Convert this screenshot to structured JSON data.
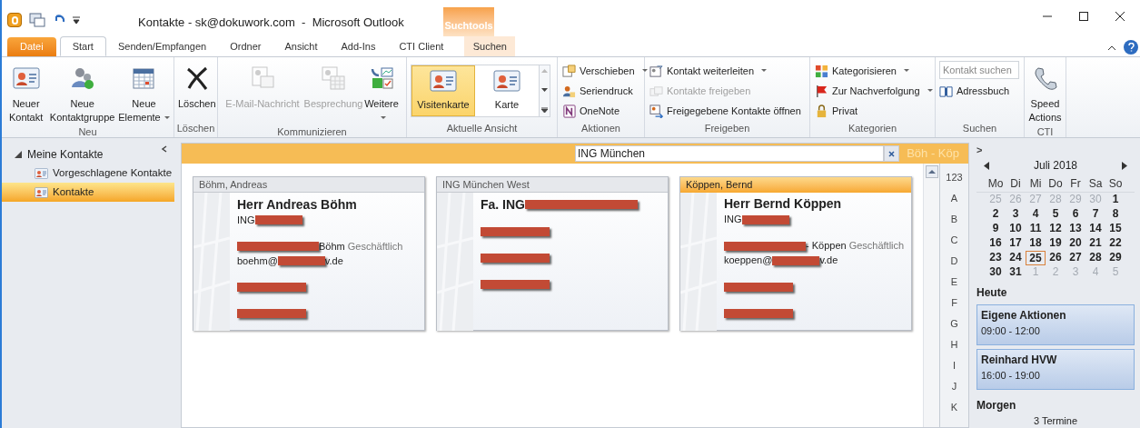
{
  "window": {
    "title": "Kontakte - sk@dokuwork.com  -  Microsoft Outlook",
    "contextual_header": "Suchtools"
  },
  "tabs": [
    {
      "label": "Datei",
      "kind": "file",
      "selected": false
    },
    {
      "label": "Start",
      "kind": "tab",
      "selected": true
    },
    {
      "label": "Senden/Empfangen",
      "kind": "tab",
      "selected": false
    },
    {
      "label": "Ordner",
      "kind": "tab",
      "selected": false
    },
    {
      "label": "Ansicht",
      "kind": "tab",
      "selected": false
    },
    {
      "label": "Add-Ins",
      "kind": "tab",
      "selected": false
    },
    {
      "label": "CTI Client",
      "kind": "tab",
      "selected": false
    },
    {
      "label": "Suchen",
      "kind": "contextual",
      "selected": false
    }
  ],
  "ribbon": {
    "groups": [
      {
        "label": "Neu",
        "items": [
          {
            "label": "Neuer Kontakt",
            "dropdown": false,
            "disabled": false
          },
          {
            "label": "Neue Kontaktgruppe",
            "dropdown": false,
            "disabled": false
          },
          {
            "label": "Neue Elemente",
            "dropdown": true,
            "disabled": false
          }
        ]
      },
      {
        "label": "Löschen",
        "items": [
          {
            "label": "Löschen",
            "dropdown": false,
            "disabled": false
          }
        ]
      },
      {
        "label": "Kommunizieren",
        "items": [
          {
            "label": "E-Mail-Nachricht",
            "dropdown": false,
            "disabled": true
          },
          {
            "label": "Besprechung",
            "dropdown": false,
            "disabled": true
          },
          {
            "label": "Weitere",
            "dropdown": true,
            "disabled": false
          }
        ]
      },
      {
        "label": "Aktuelle Ansicht",
        "items": [
          {
            "label": "Visitenkarte",
            "selected": true
          },
          {
            "label": "Karte",
            "selected": false
          }
        ]
      },
      {
        "label": "Aktionen",
        "items": [
          {
            "label": "Verschieben",
            "dropdown": true,
            "disabled": false
          },
          {
            "label": "Seriendruck",
            "dropdown": false,
            "disabled": false
          },
          {
            "label": "OneNote",
            "dropdown": false,
            "disabled": false
          }
        ]
      },
      {
        "label": "Freigeben",
        "items": [
          {
            "label": "Kontakt weiterleiten",
            "dropdown": true,
            "disabled": false
          },
          {
            "label": "Kontakte freigeben",
            "dropdown": false,
            "disabled": true
          },
          {
            "label": "Freigegebene Kontakte öffnen",
            "dropdown": false,
            "disabled": false
          }
        ]
      },
      {
        "label": "Kategorien",
        "items": [
          {
            "label": "Kategorisieren",
            "dropdown": true,
            "disabled": false
          },
          {
            "label": "Zur Nachverfolgung",
            "dropdown": true,
            "disabled": false
          },
          {
            "label": "Privat",
            "dropdown": false,
            "disabled": false
          }
        ]
      },
      {
        "label": "Suchen",
        "search": {
          "placeholder": "Kontakt suchen"
        },
        "items": [
          {
            "label": "Adressbuch",
            "dropdown": false,
            "disabled": false
          }
        ]
      },
      {
        "label": "CTI",
        "items": [
          {
            "label": "Speed Actions",
            "dropdown": false,
            "disabled": false
          }
        ]
      }
    ]
  },
  "navigation": {
    "items": [
      {
        "label": "Meine Kontakte",
        "expanded": true,
        "selected": false,
        "children": [
          {
            "label": "Vorgeschlagene Kontakte",
            "selected": false
          },
          {
            "label": "Kontakte",
            "selected": true
          }
        ]
      }
    ]
  },
  "contacts": {
    "search": {
      "value": "ING München"
    },
    "range": "Böh - Köp",
    "cards": [
      {
        "header": "Böhm, Andreas",
        "selected": false,
        "blocks": [
          [
            [
              {
                "kind": "text",
                "text": "Herr Andreas Böhm"
              }
            ],
            [
              {
                "kind": "text",
                "text": "ING "
              },
              {
                "kind": "redaction"
              }
            ]
          ],
          [
            [
              {
                "kind": "redaction"
              },
              {
                "kind": "text",
                "text": " Böhm"
              },
              {
                "kind": "label",
                "text": "Geschäftlich"
              }
            ],
            [
              {
                "kind": "text",
                "text": "boehm@"
              },
              {
                "kind": "redaction"
              },
              {
                "kind": "text",
                "text": "v.de"
              }
            ]
          ],
          [
            [
              {
                "kind": "redaction"
              }
            ]
          ],
          [
            [
              {
                "kind": "redaction"
              }
            ]
          ]
        ]
      },
      {
        "header": "ING München West",
        "selected": false,
        "blocks": [
          [
            [
              {
                "kind": "text",
                "text": "Fa. ING"
              },
              {
                "kind": "redaction"
              }
            ]
          ],
          [
            [
              {
                "kind": "redaction"
              }
            ]
          ],
          [
            [
              {
                "kind": "redaction"
              }
            ]
          ],
          [
            [
              {
                "kind": "redaction"
              }
            ]
          ]
        ]
      },
      {
        "header": "Köppen, Bernd",
        "selected": true,
        "blocks": [
          [
            [
              {
                "kind": "text",
                "text": "Herr Bernd Köppen"
              }
            ],
            [
              {
                "kind": "text",
                "text": "ING "
              },
              {
                "kind": "redaction"
              }
            ]
          ],
          [
            [
              {
                "kind": "redaction"
              },
              {
                "kind": "text",
                "text": " - Köppen"
              },
              {
                "kind": "label",
                "text": "Geschäftlich"
              }
            ],
            [
              {
                "kind": "text",
                "text": "koeppen@"
              },
              {
                "kind": "redaction"
              },
              {
                "kind": "text",
                "text": "v.de"
              }
            ]
          ],
          [
            [
              {
                "kind": "redaction"
              }
            ]
          ],
          [
            [
              {
                "kind": "redaction"
              }
            ]
          ]
        ]
      }
    ],
    "index": [
      "123",
      "A",
      "B",
      "C",
      "D",
      "E",
      "F",
      "G",
      "H",
      "I",
      "J",
      "K"
    ]
  },
  "todo_bar": {
    "expand": ">",
    "calendar": {
      "month": "Juli 2018",
      "weekdays": [
        "Mo",
        "Di",
        "Mi",
        "Do",
        "Fr",
        "Sa",
        "So"
      ],
      "weeks": [
        [
          {
            "d": "25",
            "muted": true,
            "today": false
          },
          {
            "d": "26",
            "muted": true,
            "today": false
          },
          {
            "d": "27",
            "muted": true,
            "today": false
          },
          {
            "d": "28",
            "muted": true,
            "today": false
          },
          {
            "d": "29",
            "muted": true,
            "today": false
          },
          {
            "d": "30",
            "muted": true,
            "today": false
          },
          {
            "d": "1",
            "muted": false,
            "today": false
          }
        ],
        [
          {
            "d": "2",
            "muted": false,
            "today": false
          },
          {
            "d": "3",
            "muted": false,
            "today": false
          },
          {
            "d": "4",
            "muted": false,
            "today": false
          },
          {
            "d": "5",
            "muted": false,
            "today": false
          },
          {
            "d": "6",
            "muted": false,
            "today": false
          },
          {
            "d": "7",
            "muted": false,
            "today": false
          },
          {
            "d": "8",
            "muted": false,
            "today": false
          }
        ],
        [
          {
            "d": "9",
            "muted": false,
            "today": false
          },
          {
            "d": "10",
            "muted": false,
            "today": false
          },
          {
            "d": "11",
            "muted": false,
            "today": false
          },
          {
            "d": "12",
            "muted": false,
            "today": false
          },
          {
            "d": "13",
            "muted": false,
            "today": false
          },
          {
            "d": "14",
            "muted": false,
            "today": false
          },
          {
            "d": "15",
            "muted": false,
            "today": false
          }
        ],
        [
          {
            "d": "16",
            "muted": false,
            "today": false
          },
          {
            "d": "17",
            "muted": false,
            "today": false
          },
          {
            "d": "18",
            "muted": false,
            "today": false
          },
          {
            "d": "19",
            "muted": false,
            "today": false
          },
          {
            "d": "20",
            "muted": false,
            "today": false
          },
          {
            "d": "21",
            "muted": false,
            "today": false
          },
          {
            "d": "22",
            "muted": false,
            "today": false
          }
        ],
        [
          {
            "d": "23",
            "muted": false,
            "today": false
          },
          {
            "d": "24",
            "muted": false,
            "today": false
          },
          {
            "d": "25",
            "muted": false,
            "today": true
          },
          {
            "d": "26",
            "muted": false,
            "today": false
          },
          {
            "d": "27",
            "muted": false,
            "today": false
          },
          {
            "d": "28",
            "muted": false,
            "today": false
          },
          {
            "d": "29",
            "muted": false,
            "today": false
          }
        ],
        [
          {
            "d": "30",
            "muted": false,
            "today": false
          },
          {
            "d": "31",
            "muted": false,
            "today": false
          },
          {
            "d": "1",
            "muted": true,
            "today": false
          },
          {
            "d": "2",
            "muted": true,
            "today": false
          },
          {
            "d": "3",
            "muted": true,
            "today": false
          },
          {
            "d": "4",
            "muted": true,
            "today": false
          },
          {
            "d": "5",
            "muted": true,
            "today": false
          }
        ]
      ]
    },
    "today_heading": "Heute",
    "appointments": [
      {
        "title": "Eigene Aktionen",
        "time": "09:00 - 12:00"
      },
      {
        "title": "Reinhard HVW",
        "time": "16:00 - 19:00"
      }
    ],
    "tomorrow_heading": "Morgen",
    "tomorrow_summary": "3 Termine"
  }
}
